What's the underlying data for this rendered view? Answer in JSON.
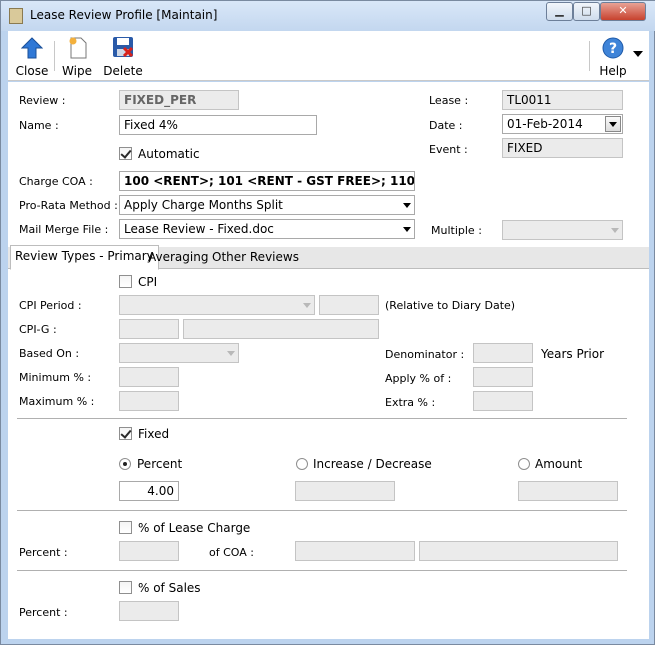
{
  "window": {
    "title": "Lease Review Profile [Maintain]",
    "controls": [
      "minimize",
      "maximize",
      "close"
    ]
  },
  "toolbar": {
    "close_label": "Close",
    "wipe_label": "Wipe",
    "delete_label": "Delete",
    "help_label": "Help"
  },
  "header": {
    "review_label": "Review :",
    "review_value": "FIXED_PER",
    "name_label": "Name :",
    "name_value": "Fixed 4%",
    "automatic_label": "Automatic",
    "automatic_checked": true,
    "lease_label": "Lease :",
    "lease_value": "TL0011",
    "date_label": "Date :",
    "date_value": "01-Feb-2014",
    "event_label": "Event :",
    "event_value": "FIXED",
    "charge_coa_label": "Charge COA :",
    "charge_coa_value": "100 <RENT>; 101 <RENT - GST FREE>; 110 <CAR PA",
    "prorata_label": "Pro-Rata Method :",
    "prorata_value": "Apply Charge Months Split",
    "mailmerge_label": "Mail Merge File :",
    "mailmerge_value": "Lease Review - Fixed.doc",
    "multiple_label": "Multiple :",
    "multiple_value": ""
  },
  "tabs": [
    {
      "label": "Review Types - Primary",
      "active": true
    },
    {
      "label": "Averaging",
      "active": false
    },
    {
      "label": "Other Reviews",
      "active": false
    }
  ],
  "cpi": {
    "cpi_label": "CPI",
    "cpi_checked": false,
    "period_label": "CPI Period :",
    "relative_label": "(Relative to Diary Date)",
    "cpig_label": "CPI-G :",
    "based_on_label": "Based On :",
    "minimum_label": "Minimum % :",
    "maximum_label": "Maximum % :",
    "denominator_label": "Denominator :",
    "years_prior_label": "Years Prior",
    "apply_label": "Apply % of :",
    "extra_label": "Extra % :"
  },
  "fixed": {
    "fixed_label": "Fixed",
    "fixed_checked": true,
    "percent_label": "Percent",
    "percent_selected": true,
    "incdec_label": "Increase / Decrease",
    "amount_label": "Amount",
    "percent_value": "4.00"
  },
  "lease_charge": {
    "label": "% of Lease Charge",
    "checked": false,
    "percent_label": "Percent :",
    "of_coa_label": "of COA :"
  },
  "sales": {
    "label": "% of Sales",
    "checked": false,
    "percent_label": "Percent :"
  }
}
